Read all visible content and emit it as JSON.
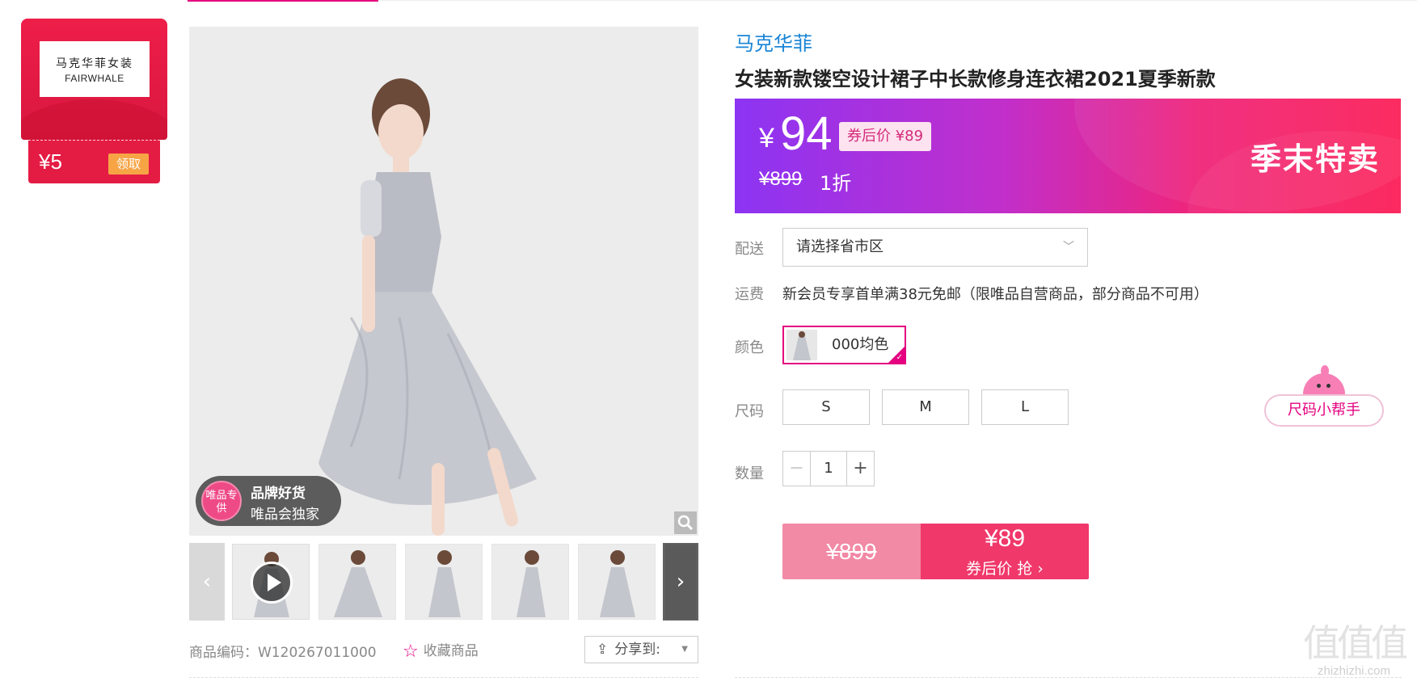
{
  "coupon": {
    "logo_cn": "马克华菲女装",
    "logo_en": "FAIRWHALE",
    "amount": "¥5",
    "claim_label": "领取"
  },
  "gallery": {
    "badge_circle": "唯品专供",
    "badge_line1": "品牌好货",
    "badge_line2": "唯品会独家",
    "prev_icon": "chevron-left-icon",
    "next_icon": "chevron-right-icon",
    "thumbnails": [
      "video",
      "photo",
      "photo",
      "photo",
      "photo",
      "photo"
    ]
  },
  "meta": {
    "sku": "商品编码：W120267011000",
    "favorite_label": "收藏商品",
    "share_label": "分享到:"
  },
  "product": {
    "brand": "马克华菲",
    "title": "女装新款镂空设计裙子中长款修身连衣裙2021夏季新款"
  },
  "price": {
    "currency": "¥",
    "current": "94",
    "coupon_price": "券后价 ¥89",
    "original": "¥899",
    "discount": "1折",
    "season_tag": "季末特卖"
  },
  "delivery": {
    "label": "配送",
    "select_placeholder": "请选择省市区"
  },
  "shipping": {
    "label": "运费",
    "text": "新会员专享首单满38元免邮（限唯品自营商品，部分商品不可用）"
  },
  "color": {
    "label": "颜色",
    "option": "000均色"
  },
  "size": {
    "label": "尺码",
    "options": [
      "S",
      "M",
      "L"
    ],
    "helper": "尺码小帮手"
  },
  "quantity": {
    "label": "数量",
    "minus": "−",
    "value": "1",
    "plus": "+"
  },
  "buy": {
    "original": "¥899",
    "price": "¥89",
    "sub": "券后价 抢 ›"
  },
  "watermark": {
    "glyph": "值值值",
    "text": "zhizhizhi.com"
  },
  "colors": {
    "accent": "#e4007f",
    "brand_blue": "#1a85d6",
    "buy_red": "#f0386a",
    "buy_pink": "#f289a5"
  }
}
